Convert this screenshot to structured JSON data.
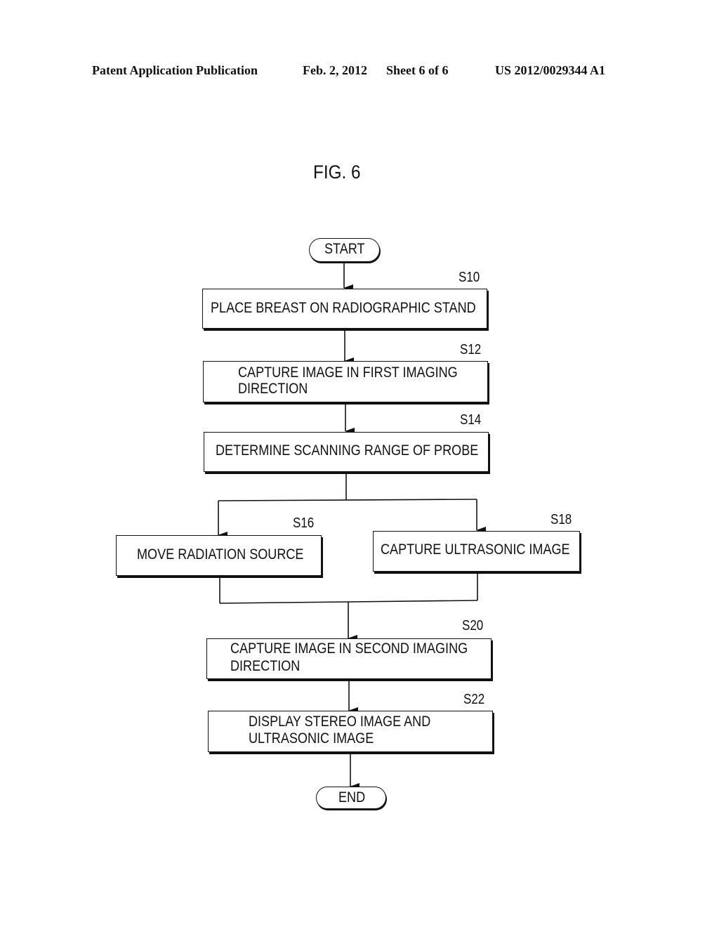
{
  "header": {
    "publication": "Patent Application Publication",
    "date": "Feb. 2, 2012",
    "sheet": "Sheet 6 of 6",
    "number": "US 2012/0029344 A1"
  },
  "figure": {
    "title": "FIG. 6"
  },
  "flowchart": {
    "start": "START",
    "end": "END",
    "steps": [
      {
        "id": "S10",
        "lines": [
          "PLACE BREAST ON RADIOGRAPHIC STAND"
        ]
      },
      {
        "id": "S12",
        "lines": [
          "CAPTURE IMAGE IN FIRST IMAGING",
          "DIRECTION"
        ]
      },
      {
        "id": "S14",
        "lines": [
          "DETERMINE SCANNING RANGE OF PROBE"
        ]
      },
      {
        "id": "S16",
        "lines": [
          "MOVE RADIATION SOURCE"
        ]
      },
      {
        "id": "S18",
        "lines": [
          "CAPTURE ULTRASONIC IMAGE"
        ]
      },
      {
        "id": "S20",
        "lines": [
          "CAPTURE IMAGE IN SECOND IMAGING",
          "DIRECTION"
        ]
      },
      {
        "id": "S22",
        "lines": [
          "DISPLAY STEREO IMAGE AND",
          "ULTRASONIC IMAGE"
        ]
      }
    ]
  }
}
